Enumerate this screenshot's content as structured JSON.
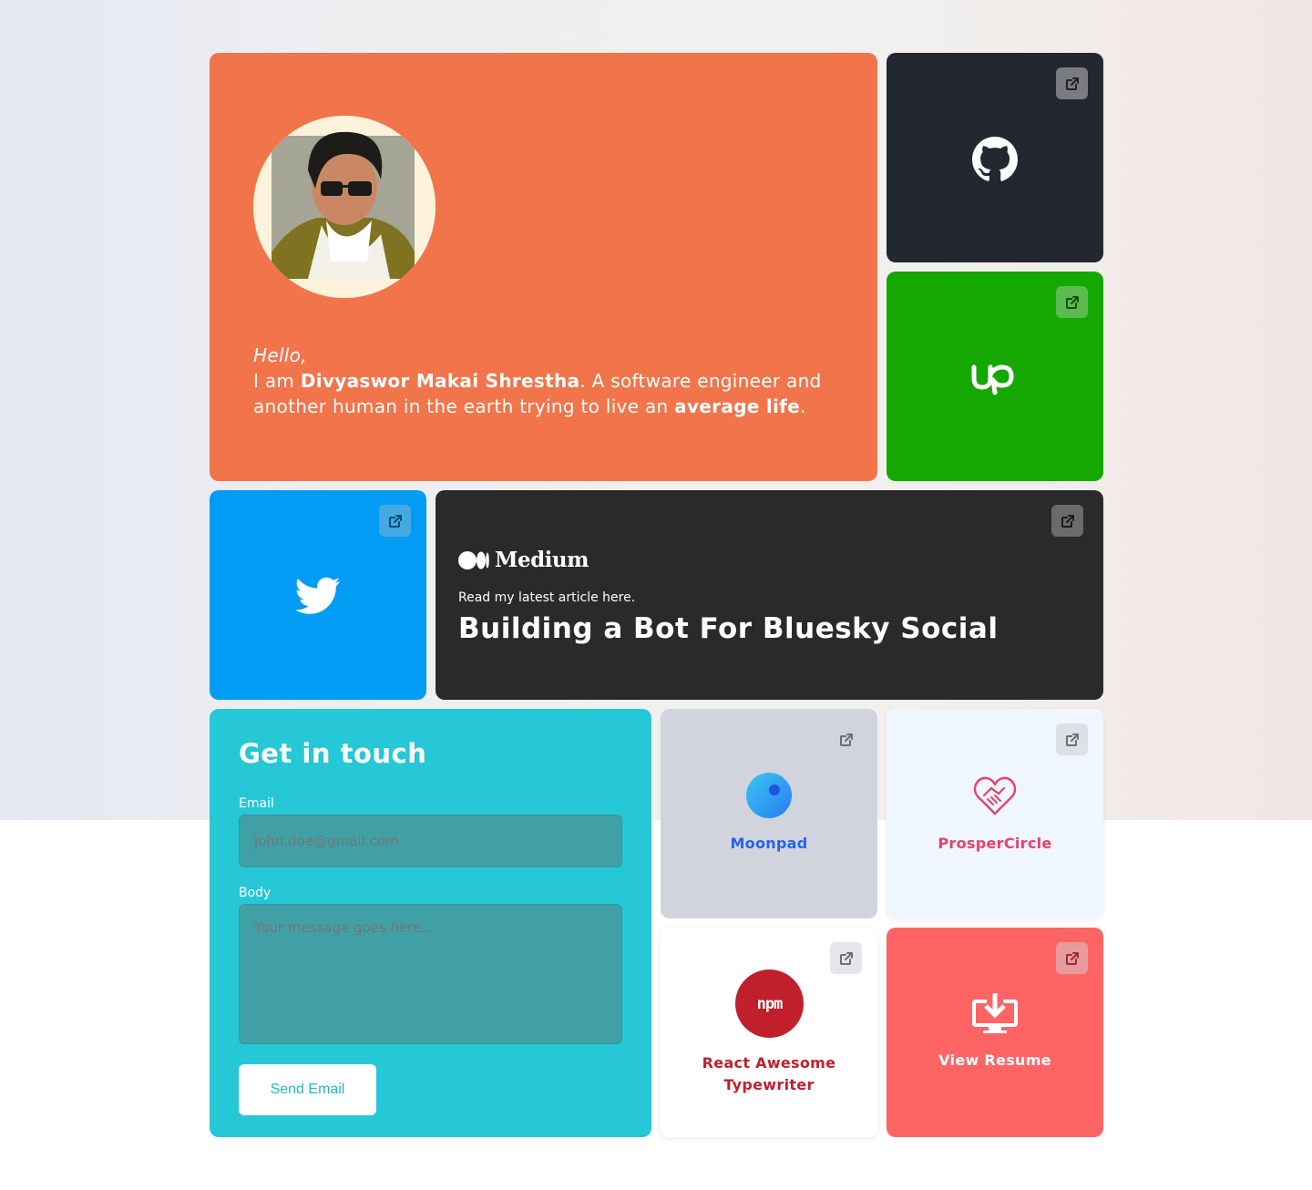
{
  "hero": {
    "greeting": "Hello,",
    "intro_prefix": "I am ",
    "name": "Divyaswor Makai Shrestha",
    "intro_middle": ". A software engineer and another human in the earth trying to live an ",
    "emphasis": "average life",
    "intro_suffix": ".",
    "background_color": "#f2744a"
  },
  "tiles": {
    "github": {
      "icon": "github-icon",
      "link_icon": "external-link-icon",
      "background_color": "#23272f"
    },
    "upwork": {
      "icon": "upwork-icon",
      "link_icon": "external-link-icon",
      "background_color": "#14a800"
    },
    "twitter": {
      "icon": "twitter-icon",
      "link_icon": "external-link-icon",
      "background_color": "#039cf4"
    }
  },
  "medium": {
    "logo_text": "Medium",
    "subtitle": "Read my latest article here.",
    "title": "Building a Bot For Bluesky Social",
    "background_color": "#2a2a2a"
  },
  "contact": {
    "title": "Get in touch",
    "email_label": "Email",
    "email_placeholder": "john.doe@gmail.com",
    "body_label": "Body",
    "body_placeholder": "Your message goes here...",
    "send_label": "Send Email",
    "background_color": "#26c7d6"
  },
  "projects": {
    "moonpad": {
      "label": "Moonpad",
      "color": "#2563eb",
      "icon": "moonpad-icon"
    },
    "prosper": {
      "label": "ProsperCircle",
      "color": "#e8416b",
      "icon": "handshake-icon"
    },
    "npm": {
      "label": "React Awesome Typewriter",
      "color": "#c21f2c",
      "icon": "npm-icon",
      "badge": "npm"
    },
    "resume": {
      "label": "View Resume",
      "color": "#ffffff",
      "icon": "download-icon"
    }
  }
}
